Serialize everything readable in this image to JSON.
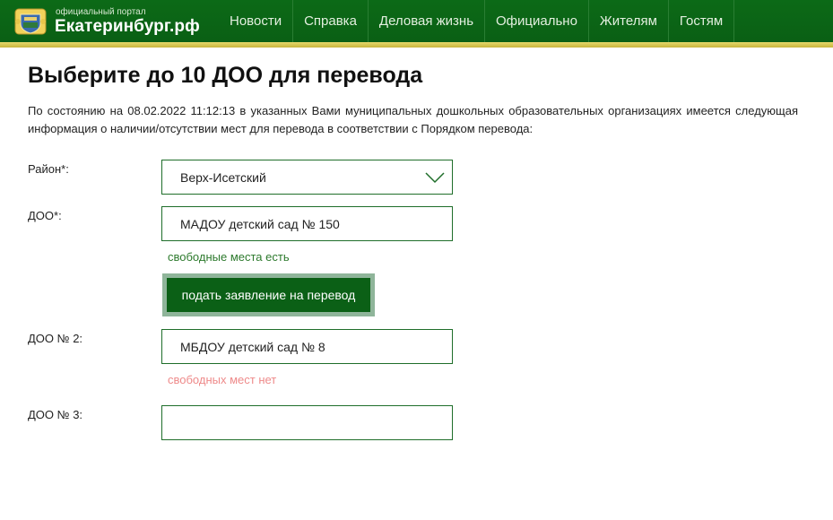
{
  "header": {
    "portal_caption": "официальный портал",
    "portal_name": "Екатеринбург.рф",
    "nav": [
      "Новости",
      "Справка",
      "Деловая жизнь",
      "Официально",
      "Жителям",
      "Гостям"
    ]
  },
  "main": {
    "title": "Выберите до 10 ДОО для перевода",
    "intro": "По состоянию на 08.02.2022 11:12:13 в указанных Вами муниципальных дошкольных образовательных организациях имеется следующая информация о наличии/отсутствии мест для перевода в соответствии с Порядком перевода:",
    "district": {
      "label": "Район*:",
      "value": "Верх-Исетский"
    },
    "doo1": {
      "label": "ДОО*:",
      "value": "МАДОУ детский сад № 150",
      "status": "свободные места есть"
    },
    "submit_label": "подать заявление на перевод",
    "doo2": {
      "label": "ДОО № 2:",
      "value": "МБДОУ детский сад № 8",
      "status": "свободных мест нет"
    },
    "doo3": {
      "label": "ДОО № 3:",
      "value": ""
    }
  },
  "colors": {
    "header_green": "#0c6a17",
    "accent_gold": "#d9c957",
    "status_yes": "#2d7a2d",
    "status_no": "#ee8a8a"
  },
  "icons": {
    "logo": "city-coat-of-arms-icon",
    "dropdown": "chevron-down-icon"
  }
}
